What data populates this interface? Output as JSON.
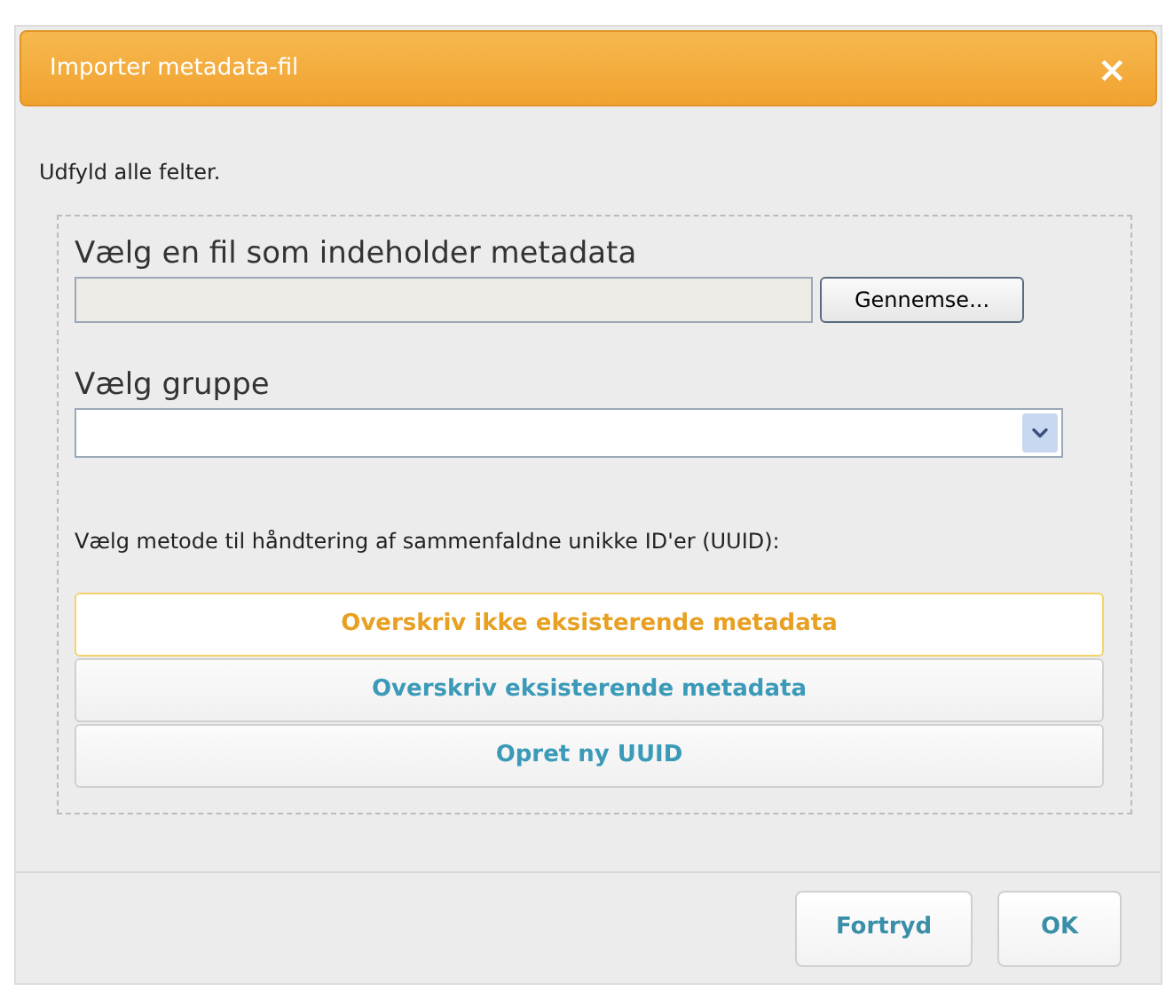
{
  "dialog": {
    "title": "Importer metadata-fil",
    "close": "×"
  },
  "intro": "Udfyld alle felter.",
  "file": {
    "label": "Vælg en fil som indeholder metadata",
    "browse_button": "Gennemse..."
  },
  "group": {
    "label": "Vælg gruppe"
  },
  "method": {
    "label": "Vælg metode til håndtering af sammenfaldne unikke ID'er (UUID):",
    "options": [
      {
        "label": "Overskriv ikke eksisterende metadata",
        "selected": true
      },
      {
        "label": "Overskriv eksisterende metadata",
        "selected": false
      },
      {
        "label": "Opret ny UUID",
        "selected": false
      }
    ]
  },
  "buttons": [
    "Fortryd",
    "OK"
  ]
}
